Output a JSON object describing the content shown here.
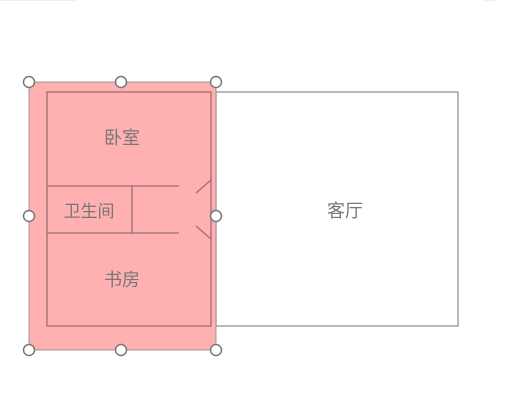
{
  "floorplan": {
    "rooms": {
      "living_room": {
        "label": "客厅"
      },
      "bedroom": {
        "label": "卧室"
      },
      "bathroom": {
        "label": "卫生间"
      },
      "study": {
        "label": "书房"
      }
    }
  },
  "colors": {
    "selection_fill": "#ffb0b0",
    "wall_stroke": "#8a8a8a",
    "label_text": "#777777",
    "handle_stroke": "#777777"
  }
}
